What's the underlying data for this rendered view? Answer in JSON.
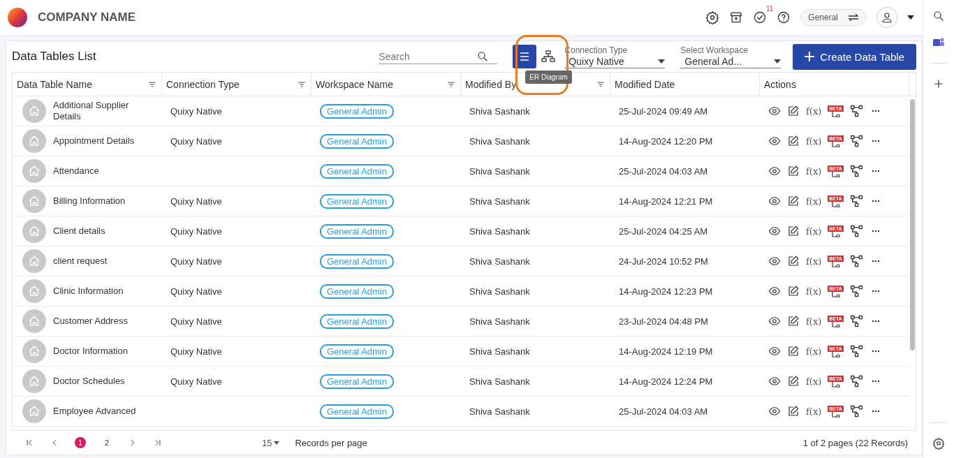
{
  "brand": {
    "name": "COMPANY NAME"
  },
  "header": {
    "notification_count": "11",
    "workspace_switch": "General"
  },
  "toolbar": {
    "title": "Data Tables List",
    "search": {
      "placeholder": "Search"
    },
    "view_buttons": [
      {
        "kind": "list",
        "selected": true
      },
      {
        "kind": "diagram",
        "selected": false
      }
    ],
    "tooltip": "ER Diagram",
    "connection_type": {
      "label": "Connection Type",
      "value": "Quixy Native"
    },
    "workspace": {
      "label": "Select Workspace",
      "value": "General Ad..."
    },
    "create_button": "Create Data Table"
  },
  "table": {
    "columns": [
      {
        "label": "Data Table Name",
        "filter": true
      },
      {
        "label": "Connection Type",
        "filter": true
      },
      {
        "label": "Workspace Name",
        "filter": true
      },
      {
        "label": "Modified By",
        "filter": true
      },
      {
        "label": "Modified Date",
        "filter": false
      },
      {
        "label": "Actions",
        "filter": false
      }
    ],
    "rows": [
      {
        "name": "Additional Supplier Details",
        "connection": "Quixy Native",
        "workspace": "General Admin",
        "modified_by": "Shiva Sashank",
        "modified_date": "25-Jul-2024 09:49 AM",
        "formula": "f(x)",
        "beta": "BETA"
      },
      {
        "name": "Appointment Details",
        "connection": "Quixy Native",
        "workspace": "General Admin",
        "modified_by": "Shiva Sashank",
        "modified_date": "14-Aug-2024 12:20 PM",
        "formula": "f(x)",
        "beta": "BETA"
      },
      {
        "name": "Attendance",
        "workspace": "General Admin",
        "modified_by": "Shiva Sashank",
        "modified_date": "25-Jul-2024 04:03 AM",
        "formula": "f(x)",
        "beta": "BETA"
      },
      {
        "name": "Billing Information",
        "connection": "Quixy Native",
        "workspace": "General Admin",
        "modified_by": "Shiva Sashank",
        "modified_date": "14-Aug-2024 12:21 PM",
        "formula": "f(x)",
        "beta": "BETA"
      },
      {
        "name": "Client details",
        "connection": "Quixy Native",
        "workspace": "General Admin",
        "modified_by": "Shiva Sashank",
        "modified_date": "25-Jul-2024 04:25 AM",
        "formula": "f(x)",
        "beta": "BETA"
      },
      {
        "name": "client request",
        "connection": "Quixy Native",
        "workspace": "General Admin",
        "modified_by": "Shiva Sashank",
        "modified_date": "24-Jul-2024 10:52 PM",
        "formula": "f(x)",
        "beta": "BETA"
      },
      {
        "name": "Clinic Information",
        "connection": "Quixy Native",
        "workspace": "General Admin",
        "modified_by": "Shiva Sashank",
        "modified_date": "14-Aug-2024 12:23 PM",
        "formula": "f(x)",
        "beta": "BETA"
      },
      {
        "name": "Customer Address",
        "connection": "Quixy Native",
        "workspace": "General Admin",
        "modified_by": "Shiva Sashank",
        "modified_date": "23-Jul-2024 04:48 PM",
        "formula": "f(x)",
        "beta": "BETA"
      },
      {
        "name": "Doctor Information",
        "connection": "Quixy Native",
        "workspace": "General Admin",
        "modified_by": "Shiva Sashank",
        "modified_date": "14-Aug-2024 12:19 PM",
        "formula": "f(x)",
        "beta": "BETA"
      },
      {
        "name": "Doctor Schedules",
        "connection": "Quixy Native",
        "workspace": "General Admin",
        "modified_by": "Shiva Sashank",
        "modified_date": "14-Aug-2024 12:24 PM",
        "formula": "f(x)",
        "beta": "BETA"
      },
      {
        "name": "Employee Advanced",
        "workspace": "General Admin",
        "modified_by": "Shiva Sashank",
        "modified_date": "25-Jul-2024 04:03 AM",
        "formula": "f(x)",
        "beta": "BETA"
      }
    ]
  },
  "pagination": {
    "pages": [
      {
        "label": "1",
        "selected": true
      },
      {
        "label": "2",
        "selected": false
      }
    ],
    "page_size": "15",
    "page_size_label": "Records per page",
    "summary": "1 of 2 pages (22 Records)"
  }
}
